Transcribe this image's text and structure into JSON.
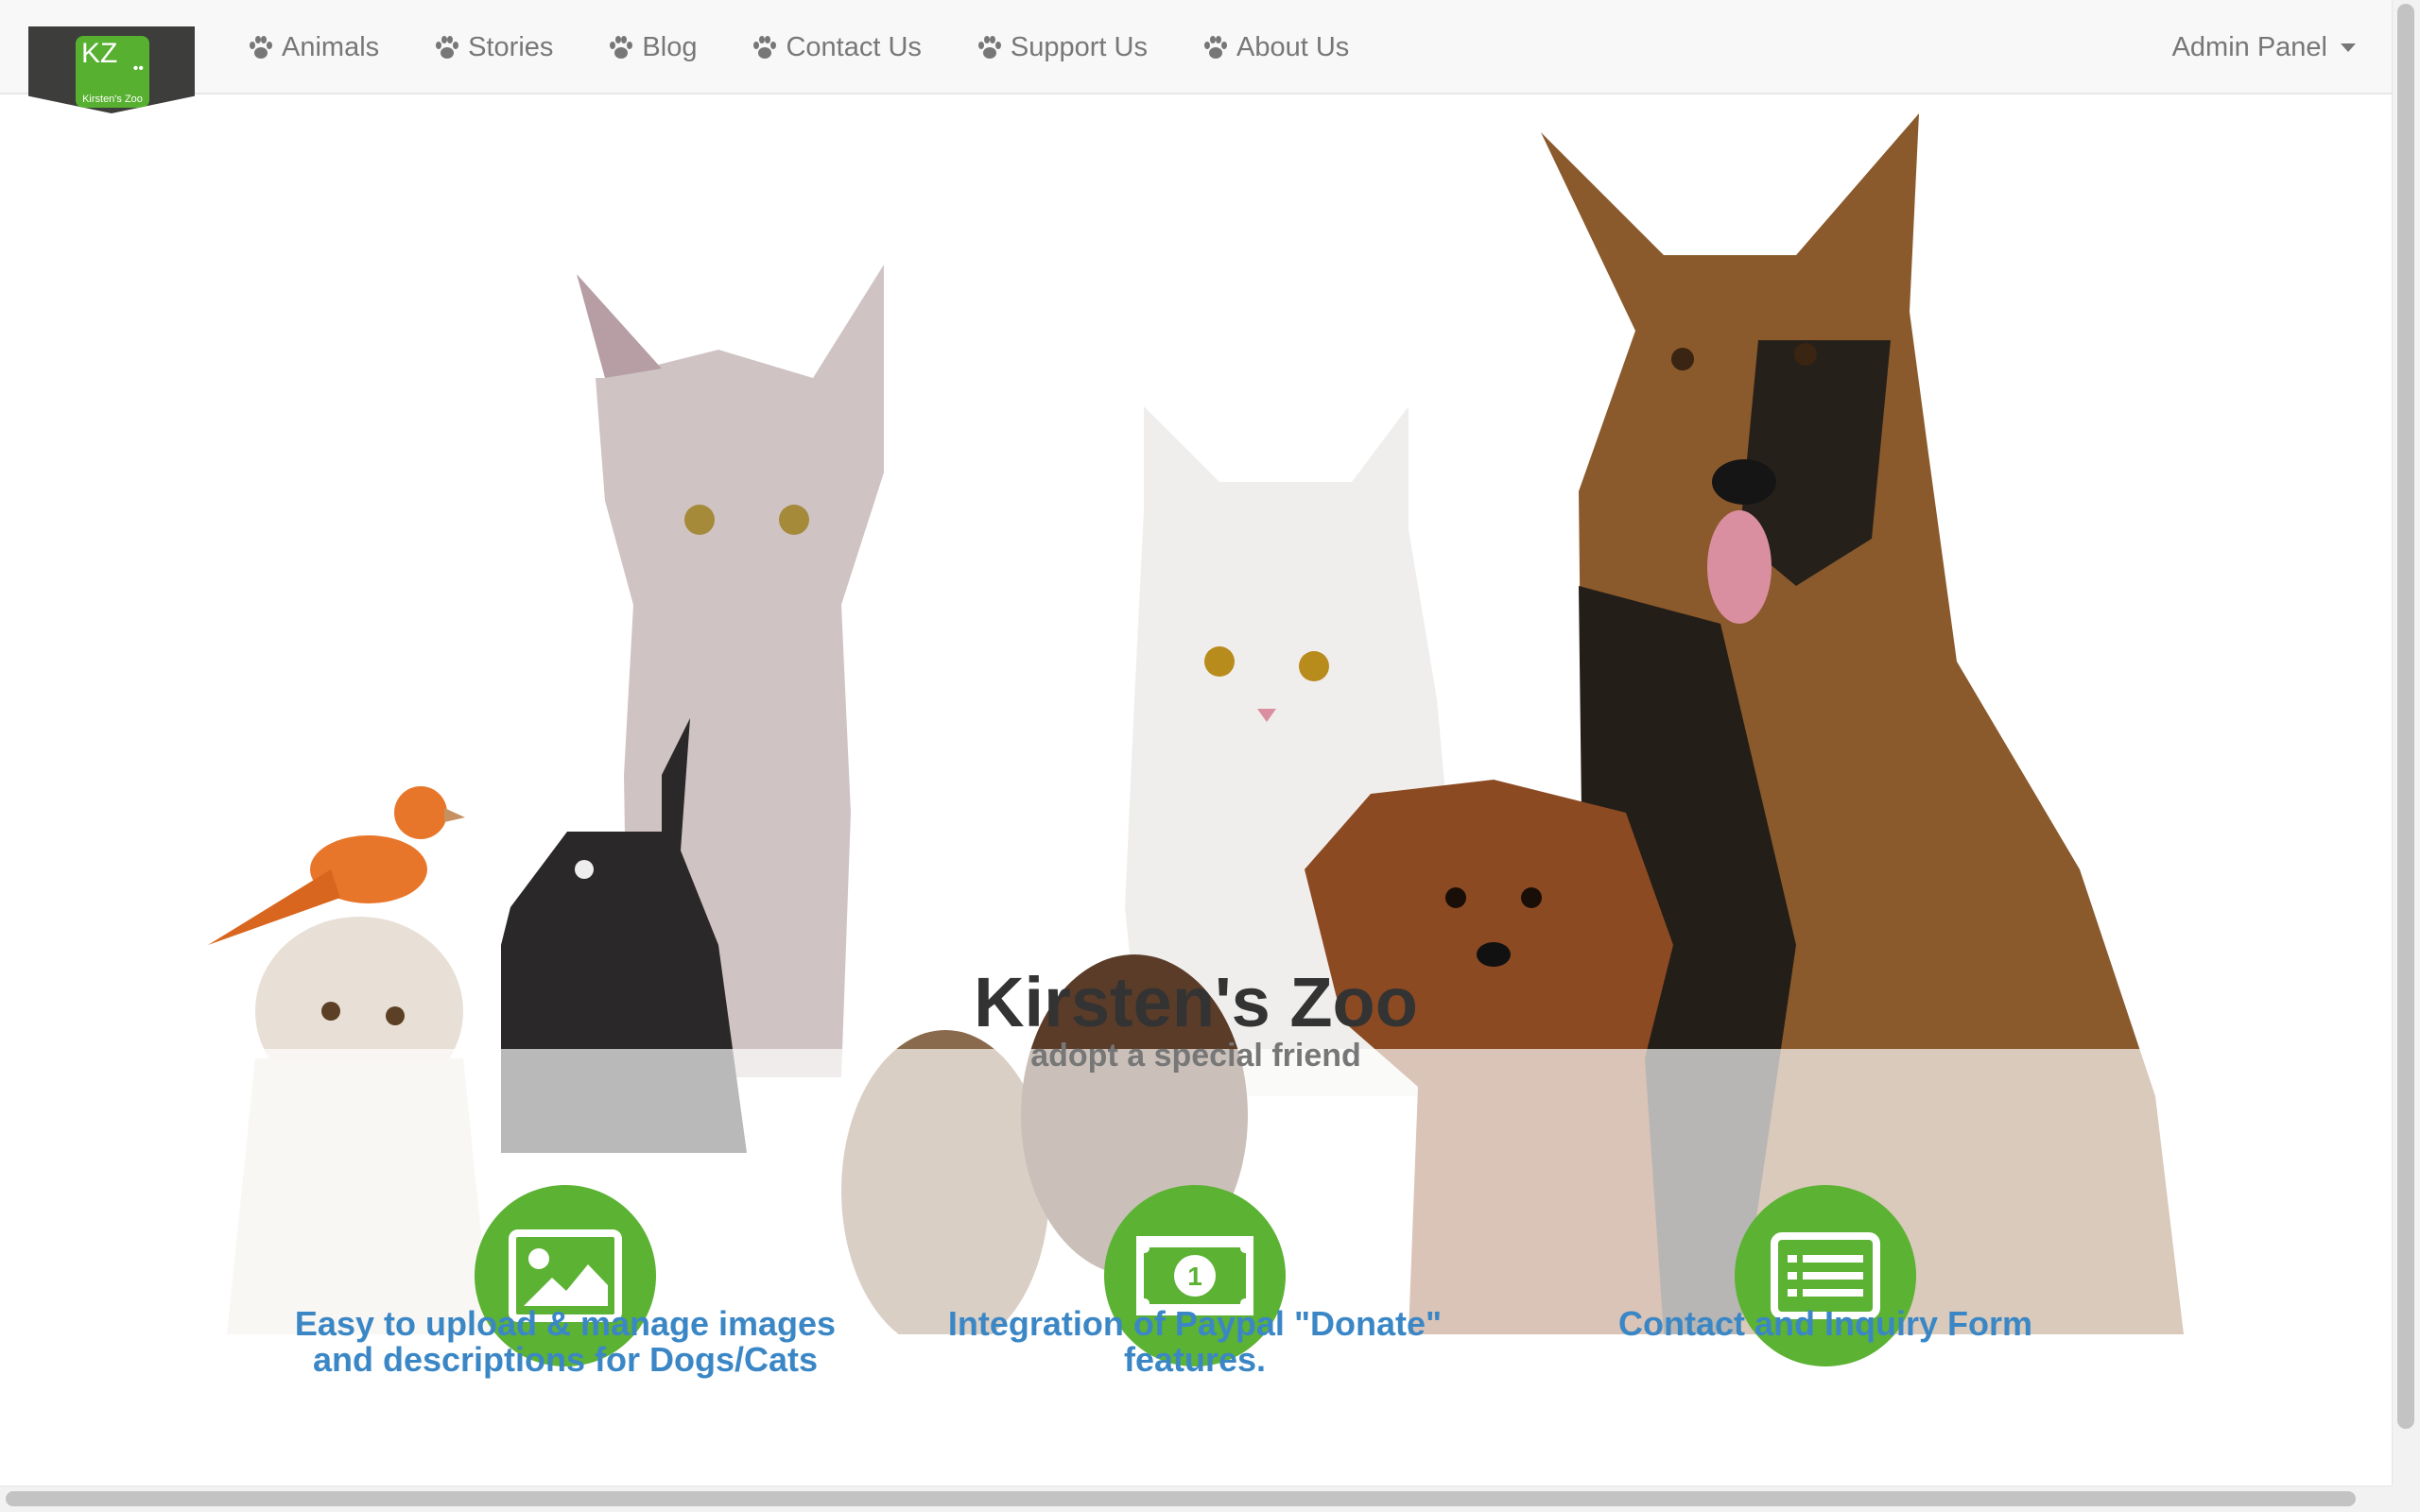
{
  "brand": {
    "logo_text": "Kirsten's Zoo",
    "logo_mark": "KZ"
  },
  "nav": {
    "items": [
      {
        "label": "Animals",
        "icon": "paw-icon"
      },
      {
        "label": "Stories",
        "icon": "paw-icon"
      },
      {
        "label": "Blog",
        "icon": "paw-icon"
      },
      {
        "label": "Contact Us",
        "icon": "paw-icon"
      },
      {
        "label": "Support Us",
        "icon": "paw-icon"
      },
      {
        "label": "About Us",
        "icon": "paw-icon"
      }
    ],
    "admin_label": "Admin Panel"
  },
  "hero": {
    "title": "Kirsten's Zoo",
    "subtitle": "adopt a special friend"
  },
  "features": [
    {
      "icon": "image-icon",
      "text": "Easy to upload & manage images and descriptions for Dogs/Cats"
    },
    {
      "icon": "dollar-bill-icon",
      "text": "Integration of Paypal \"Donate\" features."
    },
    {
      "icon": "list-icon",
      "text": "Contact and Inquiry Form"
    }
  ],
  "colors": {
    "accent_green": "#5cb233",
    "link_blue": "#3b87c6",
    "navbar_bg": "#f8f8f8"
  }
}
